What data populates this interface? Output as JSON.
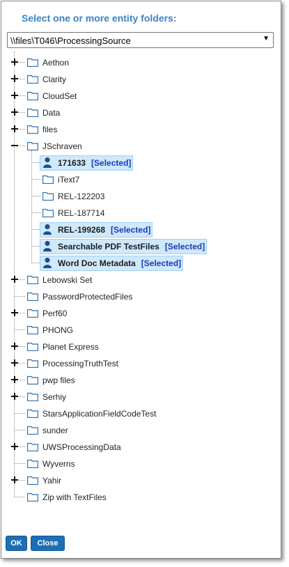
{
  "dialog": {
    "title": "Select one or more entity folders:",
    "path_value": "\\\\files\\T046\\ProcessingSource",
    "ok_label": "OK",
    "close_label": "Close"
  },
  "tree": [
    {
      "label": "Aethon",
      "level": 0,
      "expander": "plus"
    },
    {
      "label": "Clarity",
      "level": 0,
      "expander": "plus"
    },
    {
      "label": "CloudSet",
      "level": 0,
      "expander": "plus"
    },
    {
      "label": "Data",
      "level": 0,
      "expander": "plus"
    },
    {
      "label": "files",
      "level": 0,
      "expander": "plus"
    },
    {
      "label": "JSchraven",
      "level": 0,
      "expander": "minus"
    },
    {
      "label": "171633",
      "level": 1,
      "selected": true
    },
    {
      "label": "iText7",
      "level": 1
    },
    {
      "label": "REL-122203",
      "level": 1
    },
    {
      "label": "REL-187714",
      "level": 1
    },
    {
      "label": "REL-199268",
      "level": 1,
      "selected": true
    },
    {
      "label": "Searchable PDF TestFiles",
      "level": 1,
      "selected": true
    },
    {
      "label": "Word Doc Metadata",
      "level": 1,
      "selected": true
    },
    {
      "label": "Lebowski Set",
      "level": 0,
      "expander": "plus"
    },
    {
      "label": "PasswordProtectedFiles",
      "level": 0
    },
    {
      "label": "Perf60",
      "level": 0,
      "expander": "plus"
    },
    {
      "label": "PHONG",
      "level": 0
    },
    {
      "label": "Planet Express",
      "level": 0,
      "expander": "plus"
    },
    {
      "label": "ProcessingTruthTest",
      "level": 0,
      "expander": "plus"
    },
    {
      "label": "pwp files",
      "level": 0,
      "expander": "plus"
    },
    {
      "label": "Serhiy",
      "level": 0,
      "expander": "plus"
    },
    {
      "label": "StarsApplicationFieldCodeTest",
      "level": 0
    },
    {
      "label": "sunder",
      "level": 0
    },
    {
      "label": "UWSProcessingData",
      "level": 0,
      "expander": "plus"
    },
    {
      "label": "Wyverns",
      "level": 0
    },
    {
      "label": "Yahir",
      "level": 0,
      "expander": "plus"
    },
    {
      "label": "Zip with TextFiles",
      "level": 0
    }
  ],
  "selected_tag": "[Selected]",
  "icons": {
    "folder": "folder-icon",
    "person": "person-icon",
    "expand": "plus-icon",
    "collapse": "minus-icon",
    "dropdown": "chevron-down-icon"
  },
  "colors": {
    "title": "#3b82c4",
    "folder": "#2d6fb0",
    "selected_bg": "#cfe8fb",
    "selected_tag": "#1b39b8",
    "button": "#1e6eb5"
  }
}
